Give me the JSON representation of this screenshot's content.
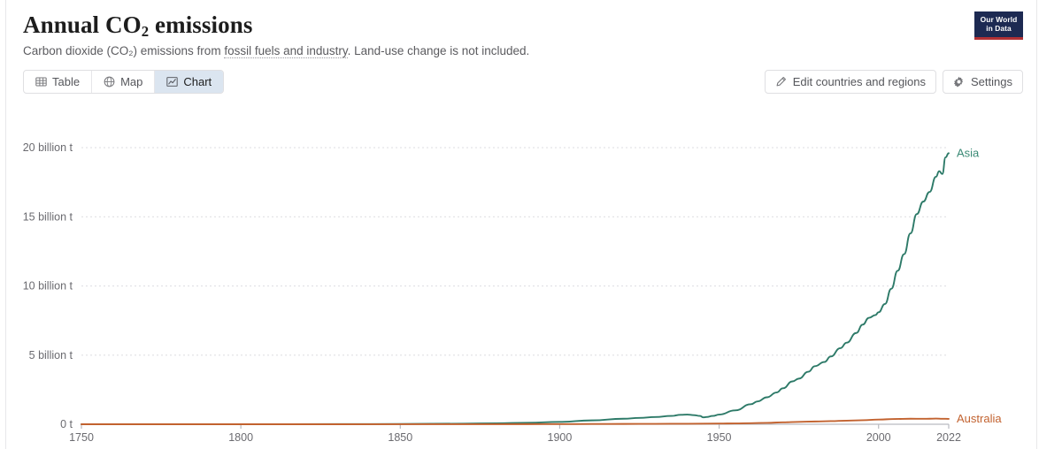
{
  "header": {
    "title_main": "Annual CO",
    "title_sub": "2",
    "title_tail": " emissions",
    "subtitle_pre": "Carbon dioxide (CO₂) emissions from ",
    "subtitle_link": "fossil fuels and industry",
    "subtitle_post": ". Land-use change is not included.",
    "logo_line1": "Our World",
    "logo_line2": "in Data",
    "logo_bg": "#1d2a52",
    "logo_accent": "#b13135"
  },
  "tabs": [
    {
      "label": "Table",
      "icon": "table-icon",
      "active": false
    },
    {
      "label": "Map",
      "icon": "globe-icon",
      "active": false
    },
    {
      "label": "Chart",
      "icon": "line-chart-icon",
      "active": true
    }
  ],
  "actions": [
    {
      "label": "Edit countries and regions",
      "icon": "pencil-icon"
    },
    {
      "label": "Settings",
      "icon": "gear-icon"
    }
  ],
  "chart_data": {
    "type": "line",
    "title": "Annual CO2 emissions",
    "subtitle": "Carbon dioxide (CO2) emissions from fossil fuels and industry. Land-use change is not included.",
    "xlabel": "",
    "ylabel": "",
    "xlim": [
      1750,
      2022
    ],
    "ylim": [
      0,
      22500000000
    ],
    "grid": true,
    "legend_position": "end-of-line",
    "x_tick_labels": [
      "1750",
      "1800",
      "1850",
      "1900",
      "1950",
      "2000",
      "2022"
    ],
    "x_ticks": [
      1750,
      1800,
      1850,
      1900,
      1950,
      2000,
      2022
    ],
    "y_tick_labels": [
      "0 t",
      "5 billion t",
      "10 billion t",
      "15 billion t",
      "20 billion t"
    ],
    "y_ticks": [
      0,
      5000000000,
      10000000000,
      15000000000,
      20000000000
    ],
    "y_unit": "tonnes",
    "series": [
      {
        "name": "Asia",
        "color": "#2d7a68",
        "label_color": "#3a8a75",
        "x": [
          1750,
          1800,
          1830,
          1850,
          1870,
          1880,
          1890,
          1900,
          1910,
          1920,
          1925,
          1930,
          1935,
          1938,
          1940,
          1942,
          1944,
          1945,
          1946,
          1948,
          1950,
          1955,
          1960,
          1962,
          1965,
          1968,
          1970,
          1973,
          1975,
          1978,
          1980,
          1983,
          1985,
          1988,
          1990,
          1993,
          1995,
          1997,
          1999,
          2000,
          2002,
          2004,
          2006,
          2008,
          2010,
          2012,
          2014,
          2016,
          2018,
          2019,
          2020,
          2021,
          2022
        ],
        "y": [
          0,
          2000000,
          8000000,
          20000000,
          45000000,
          70000000,
          110000000,
          170000000,
          280000000,
          400000000,
          460000000,
          520000000,
          600000000,
          680000000,
          700000000,
          660000000,
          600000000,
          500000000,
          520000000,
          600000000,
          700000000,
          1000000000,
          1450000000,
          1650000000,
          1950000000,
          2300000000,
          2600000000,
          3100000000,
          3300000000,
          3800000000,
          4200000000,
          4500000000,
          4900000000,
          5500000000,
          5900000000,
          6600000000,
          7200000000,
          7700000000,
          7900000000,
          8100000000,
          8700000000,
          9800000000,
          11100000000,
          12300000000,
          13800000000,
          15200000000,
          16100000000,
          16800000000,
          17900000000,
          18300000000,
          18100000000,
          19300000000,
          19600000000
        ]
      },
      {
        "name": "Australia",
        "color": "#c2622f",
        "label_color": "#c2622f",
        "x": [
          1750,
          1800,
          1850,
          1870,
          1890,
          1900,
          1910,
          1920,
          1930,
          1940,
          1950,
          1955,
          1960,
          1965,
          1970,
          1975,
          1980,
          1985,
          1990,
          1995,
          2000,
          2005,
          2010,
          2014,
          2016,
          2018,
          2020,
          2022
        ],
        "y": [
          0,
          0,
          1000000,
          3000000,
          8000000,
          12000000,
          18000000,
          24000000,
          28000000,
          38000000,
          50000000,
          62000000,
          78000000,
          100000000,
          140000000,
          170000000,
          200000000,
          225000000,
          260000000,
          290000000,
          340000000,
          380000000,
          400000000,
          395000000,
          400000000,
          410000000,
          395000000,
          390000000
        ]
      }
    ]
  }
}
